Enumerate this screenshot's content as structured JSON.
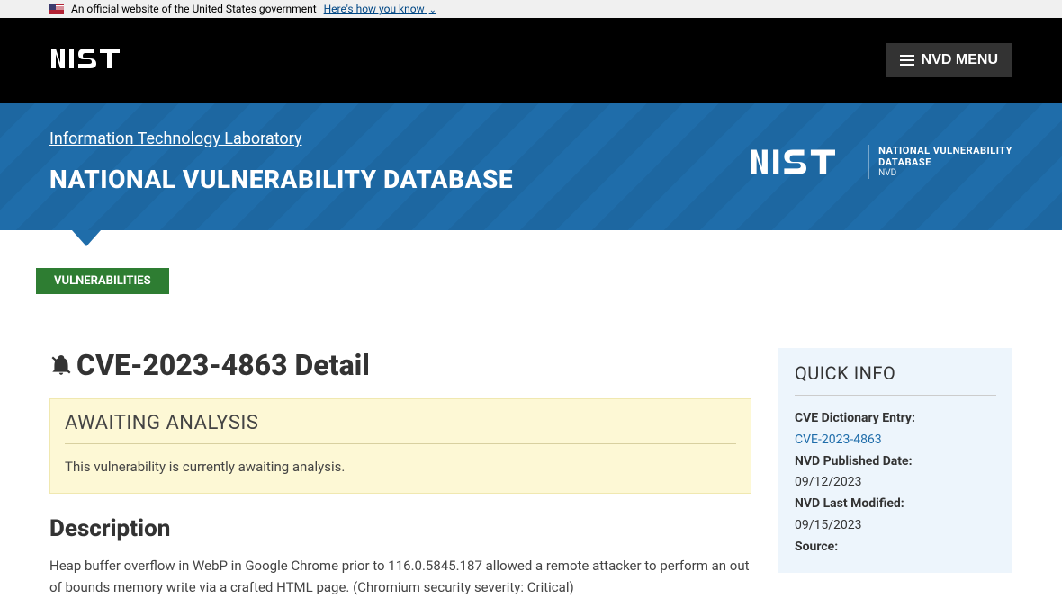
{
  "gov_banner": {
    "text": "An official website of the United States government",
    "link_text": "Here's how you know"
  },
  "header": {
    "menu_label": "NVD MENU"
  },
  "banner": {
    "itl_link": "Information Technology Laboratory",
    "title": "NATIONAL VULNERABILITY DATABASE",
    "right_l1": "NATIONAL VULNERABILITY",
    "right_l2": "DATABASE",
    "right_l3": "NVD"
  },
  "tag": "VULNERABILITIES",
  "page_title": "CVE-2023-4863 Detail",
  "status": {
    "title": "AWAITING ANALYSIS",
    "body": "This vulnerability is currently awaiting analysis."
  },
  "description": {
    "heading": "Description",
    "body": "Heap buffer overflow in WebP in Google Chrome prior to 116.0.5845.187 allowed a remote attacker to perform an out of bounds memory write via a crafted HTML page. (Chromium security severity: Critical)"
  },
  "quick_info": {
    "heading": "QUICK INFO",
    "entry_label": "CVE Dictionary Entry:",
    "entry_value": "CVE-2023-4863",
    "published_label": "NVD Published Date:",
    "published_value": "09/12/2023",
    "modified_label": "NVD Last Modified:",
    "modified_value": "09/15/2023",
    "source_label": "Source:"
  }
}
